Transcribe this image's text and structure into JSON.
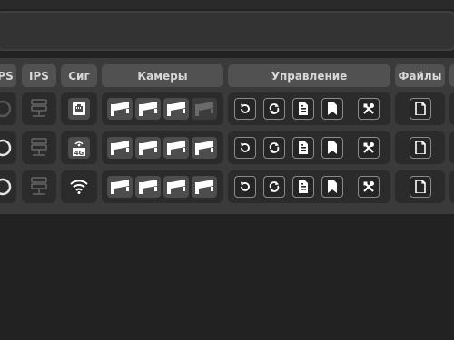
{
  "headers": {
    "ups": "PS",
    "ips": "IPS",
    "signal": "Сиг",
    "cameras": "Камеры",
    "control": "Управление",
    "files": "Файлы"
  },
  "icons": {
    "server": "server-icon",
    "ethernet": "ethernet-port-icon",
    "lte": "lte-4g-icon",
    "wifi": "wifi-icon",
    "camera": "security-camera-icon",
    "restart": "restart-icon",
    "sync": "sync-icon",
    "log": "log-file-icon",
    "bookmark": "bookmark-icon",
    "settings": "tools-icon",
    "file": "file-icon"
  },
  "rows": [
    {
      "signal_type": "ethernet",
      "signal_label": "",
      "cameras": [
        "1",
        "2",
        "3",
        "4"
      ],
      "cameras_active": [
        true,
        true,
        true,
        false
      ]
    },
    {
      "signal_type": "lte",
      "signal_label": "4G",
      "cameras": [
        "1",
        "2",
        "3",
        "4"
      ],
      "cameras_active": [
        true,
        true,
        true,
        true
      ]
    },
    {
      "signal_type": "wifi",
      "signal_label": "",
      "cameras": [
        "1",
        "2",
        "3",
        "4"
      ],
      "cameras_active": [
        true,
        true,
        true,
        true
      ]
    }
  ],
  "colors": {
    "background": "#222222",
    "band": "#3a3a3a",
    "header": "#515151",
    "cell": "#2b2b2b",
    "camera_active": "#4d4d4d",
    "camera_inactive": "#3c3c3c"
  }
}
